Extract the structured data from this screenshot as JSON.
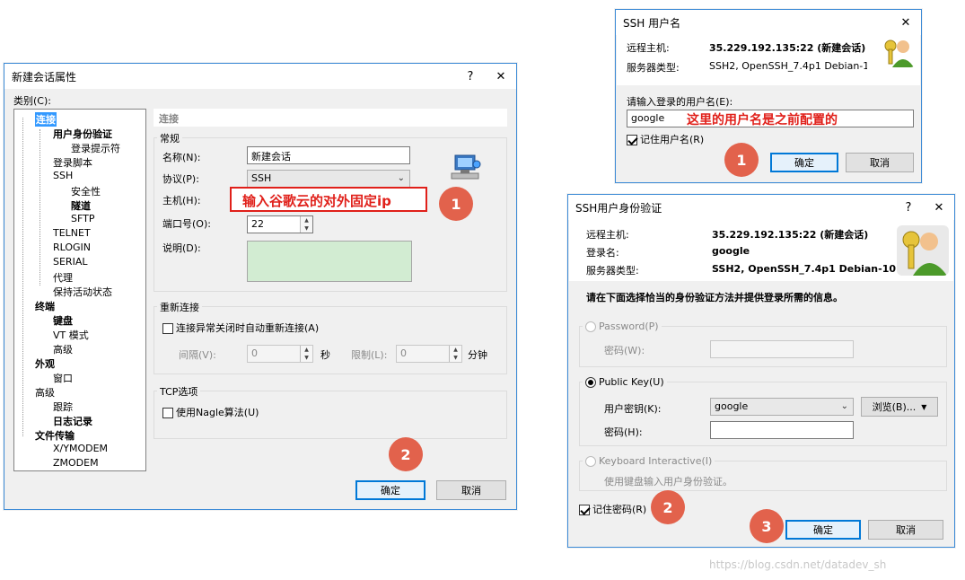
{
  "left_dialog": {
    "title": "新建会话属性",
    "help": "?",
    "close": "✕",
    "category_label": "类别(C):",
    "tree": [
      {
        "label": "连接",
        "bold": true,
        "sel": true
      },
      {
        "label": "用户身份验证",
        "bold": true
      },
      {
        "label": "登录提示符"
      },
      {
        "label": "登录脚本"
      },
      {
        "label": "SSH"
      },
      {
        "label": "安全性"
      },
      {
        "label": "隧道",
        "bold": true
      },
      {
        "label": "SFTP"
      },
      {
        "label": "TELNET"
      },
      {
        "label": "RLOGIN"
      },
      {
        "label": "SERIAL"
      },
      {
        "label": "代理"
      },
      {
        "label": "保持活动状态"
      },
      {
        "label": "终端",
        "bold": true
      },
      {
        "label": "键盘",
        "bold": true
      },
      {
        "label": "VT 模式"
      },
      {
        "label": "高级"
      },
      {
        "label": "外观",
        "bold": true
      },
      {
        "label": "窗口"
      },
      {
        "label": "高级"
      },
      {
        "label": "跟踪"
      },
      {
        "label": "日志记录",
        "bold": true
      },
      {
        "label": "文件传输",
        "bold": true
      },
      {
        "label": "X/YMODEM"
      },
      {
        "label": "ZMODEM"
      }
    ],
    "section_title": "连接",
    "general_label": "常规",
    "name_label": "名称(N):",
    "name_value": "新建会话",
    "protocol_label": "协议(P):",
    "protocol_value": "SSH",
    "host_label": "主机(H):",
    "host_annotation": "输入谷歌云的对外固定ip",
    "port_label": "端口号(O):",
    "port_value": "22",
    "desc_label": "说明(D):",
    "reconnect_label": "重新连接",
    "reconnect_check": "连接异常关闭时自动重新连接(A)",
    "interval_label": "间隔(V):",
    "interval_value": "0",
    "seconds": "秒",
    "limit_label": "限制(L):",
    "limit_value": "0",
    "minutes": "分钟",
    "tcp_label": "TCP选项",
    "nagle_check": "使用Nagle算法(U)",
    "ok": "确定",
    "cancel": "取消",
    "marker1": "1",
    "marker2": "2"
  },
  "username_dialog": {
    "title": "SSH 用户名",
    "close": "✕",
    "remote_host_label": "远程主机:",
    "remote_host_value": "35.229.192.135:22 (新建会话)",
    "server_type_label": "服务器类型:",
    "server_type_value": "SSH2, OpenSSH_7.4p1 Debian-1",
    "prompt": "请输入登录的用户名(E):",
    "username_value": "google",
    "annotation": "这里的用户名是之前配置的",
    "remember": "记住用户名(R)",
    "ok": "确定",
    "cancel": "取消",
    "marker": "1"
  },
  "auth_dialog": {
    "title": "SSH用户身份验证",
    "help": "?",
    "close": "✕",
    "remote_host_label": "远程主机:",
    "remote_host_value": "35.229.192.135:22 (新建会话)",
    "login_label": "登录名:",
    "login_value": "google",
    "server_type_label": "服务器类型:",
    "server_type_value": "SSH2, OpenSSH_7.4p1 Debian-10+",
    "instruction": "请在下面选择恰当的身份验证方法并提供登录所需的信息。",
    "password_option": "Password(P)",
    "password_label": "密码(W):",
    "pubkey_option": "Public Key(U)",
    "user_key_label": "用户密钥(K):",
    "user_key_value": "google",
    "browse": "浏览(B)...",
    "passphrase_label": "密码(H):",
    "kbd_option": "Keyboard Interactive(I)",
    "kbd_desc": "使用键盘输入用户身份验证。",
    "remember": "记住密码(R)",
    "ok": "确定",
    "cancel": "取消",
    "marker2": "2",
    "marker3": "3"
  },
  "watermark": "https://blog.csdn.net/datadev_sh"
}
